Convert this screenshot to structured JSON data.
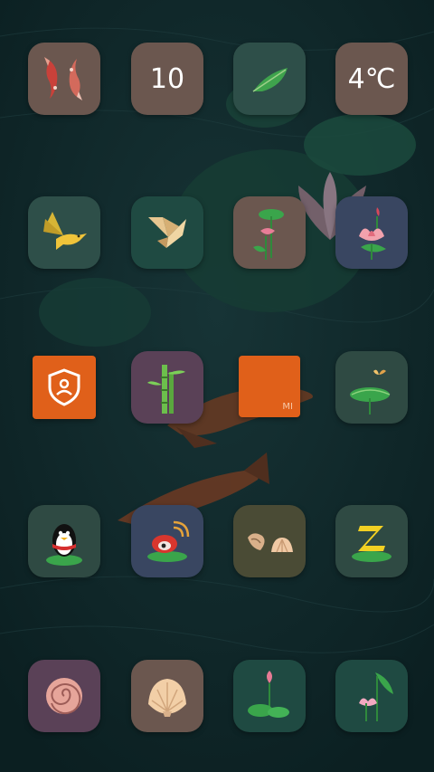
{
  "colors": {
    "background": "#0f2628",
    "tile_brown": "#6b574f",
    "tile_green": "#2e4f49",
    "tile_plum": "#5a4157",
    "tile_slate": "#394661",
    "tile_olive": "#4a4b35",
    "accent_orange": "#e0601a"
  },
  "home": {
    "calendar_day": "10",
    "weather_temp": "4℃",
    "mi_brand": "MI"
  },
  "icons": [
    "koi-fish-icon",
    "calendar-icon",
    "leaf-icon",
    "weather-icon",
    "golden-bird-icon",
    "paper-crane-icon",
    "lotus-bud-icon",
    "pink-lotus-icon",
    "security-shield-icon",
    "bamboo-icon",
    "mi-store-icon",
    "lotus-butterfly-icon",
    "penguin-qq-icon",
    "weibo-icon",
    "seashells-icon",
    "sleep-z-icon",
    "spiral-shell-icon",
    "scallop-shell-icon",
    "lotus-pad-icon",
    "lotus-flower-icon"
  ]
}
